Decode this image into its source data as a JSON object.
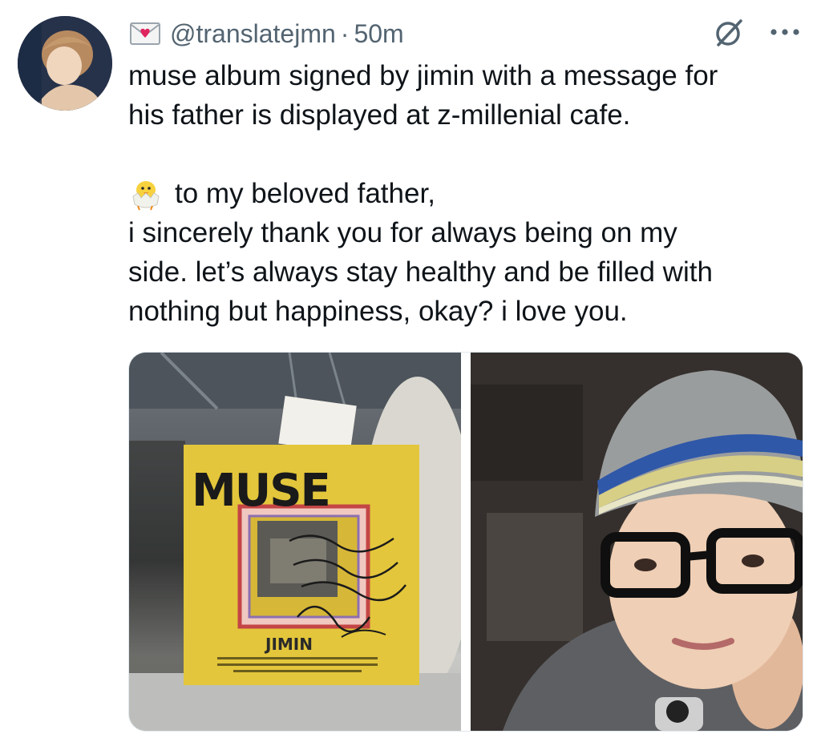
{
  "tweet": {
    "handle": "@translatejmn",
    "separator": "·",
    "time": "50m",
    "lines": [
      "muse album signed by jimin with a message for",
      "his father is displayed at z-millenial cafe.",
      "to my beloved father,",
      "i sincerely thank you for always being on my",
      "side. let’s always stay healthy and be filled with",
      "nothing but happiness, okay? i love you."
    ]
  },
  "media": {
    "album_title": "MUSE",
    "album_artist": "JIMIN"
  },
  "icons": {
    "header_emoji": "love-letter-icon",
    "message_emoji": "hatching-chick-icon",
    "grok": "grok-icon",
    "more": "more-icon"
  },
  "colors": {
    "text": "#0f1419",
    "muted": "#536471",
    "album_yellow": "#e8c93a"
  }
}
